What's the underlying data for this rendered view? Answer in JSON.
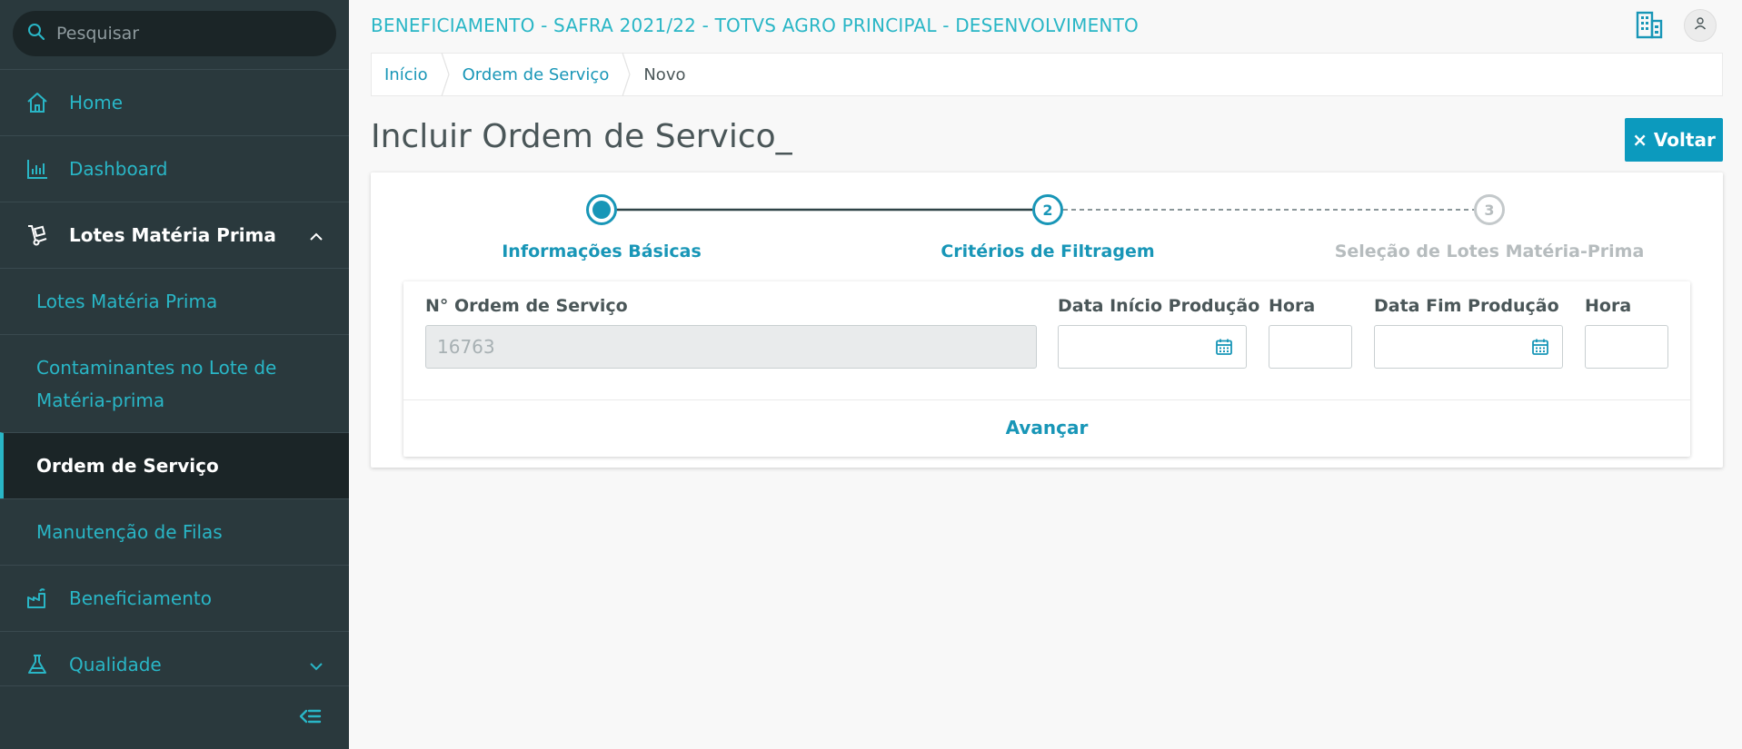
{
  "sidebar": {
    "search_placeholder": "Pesquisar",
    "items": [
      {
        "label": "Home",
        "icon": "home-icon"
      },
      {
        "label": "Dashboard",
        "icon": "chart-icon"
      },
      {
        "label": "Lotes Matéria Prima",
        "icon": "handtruck-icon",
        "expanded": true
      },
      {
        "label": "Beneficiamento",
        "icon": "factory-icon"
      },
      {
        "label": "Qualidade",
        "icon": "flask-icon"
      }
    ],
    "subitems": [
      {
        "label": "Lotes Matéria Prima"
      },
      {
        "label": "Contaminantes no Lote de Matéria-prima"
      },
      {
        "label": "Ordem de Serviço",
        "active": true
      },
      {
        "label": "Manutenção de Filas"
      }
    ]
  },
  "header": {
    "title": "BENEFICIAMENTO - SAFRA 2021/22 - TOTVS AGRO PRINCIPAL - DESENVOLVIMENTO"
  },
  "breadcrumb": {
    "items": [
      "Início",
      "Ordem de Serviço",
      "Novo"
    ]
  },
  "page": {
    "title": "Incluir Ordem de Servico_",
    "back_label": "× Voltar"
  },
  "stepper": {
    "steps": [
      {
        "number": "",
        "label": "Informações Básicas",
        "state": "done"
      },
      {
        "number": "2",
        "label": "Critérios de Filtragem",
        "state": "current"
      },
      {
        "number": "3",
        "label": "Seleção de Lotes Matéria-Prima",
        "state": "pending"
      }
    ]
  },
  "form": {
    "os_label": "N° Ordem de Serviço",
    "os_value": "16763",
    "start_date_label": "Data Início Produção",
    "start_time_label": "Hora",
    "end_date_label": "Data Fim Produção",
    "end_time_label": "Hora",
    "advance_label": "Avançar"
  },
  "colors": {
    "accent": "#29b6c6",
    "primary_button": "#0c9abe",
    "sidebar_bg": "#2a393d"
  }
}
